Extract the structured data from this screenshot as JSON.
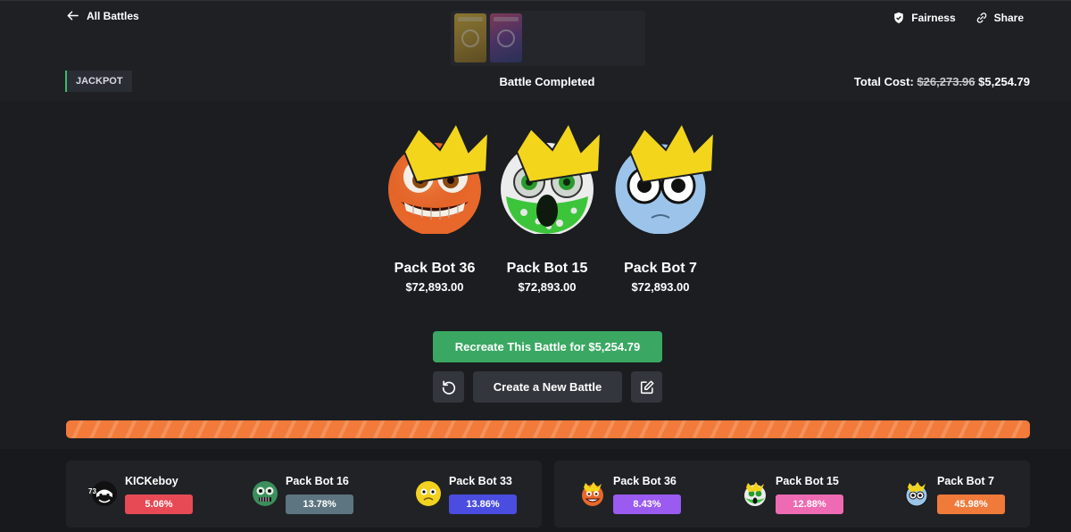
{
  "nav": {
    "back_label": "All Battles"
  },
  "actions": {
    "fairness_label": "Fairness",
    "share_label": "Share"
  },
  "battle": {
    "mode": "JACKPOT",
    "status": "Battle Completed",
    "cost_label": "Total Cost:",
    "cost_original": "$26,273.96",
    "cost_final": "$5,254.79"
  },
  "winners": [
    {
      "name": "Pack Bot 36",
      "amount": "$72,893.00",
      "avatar_icon": "orange-grin-bot-icon"
    },
    {
      "name": "Pack Bot 15",
      "amount": "$72,893.00",
      "avatar_icon": "green-spotted-bot-icon"
    },
    {
      "name": "Pack Bot 7",
      "amount": "$72,893.00",
      "avatar_icon": "blue-eyed-bot-icon"
    }
  ],
  "buttons": {
    "recreate_label": "Recreate This Battle for $5,254.79",
    "new_battle_label": "Create a New Battle"
  },
  "progress": {
    "fraction": 1.0,
    "color": "#f27a3a"
  },
  "teams": [
    {
      "players": [
        {
          "name": "KICKeboy",
          "chance": "5.06%",
          "color": "#e84a55",
          "level": "73",
          "avatar_icon": "ninja-avatar-icon"
        },
        {
          "name": "Pack Bot 16",
          "chance": "13.78%",
          "color": "#5d7580",
          "avatar_icon": "green-zombie-bot-icon"
        },
        {
          "name": "Pack Bot 33",
          "chance": "13.86%",
          "color": "#4a4de0",
          "avatar_icon": "yellow-frown-bot-icon"
        }
      ]
    },
    {
      "players": [
        {
          "name": "Pack Bot 36",
          "chance": "8.43%",
          "color": "#9b5af0",
          "avatar_icon": "crowned-orange-bot-icon"
        },
        {
          "name": "Pack Bot 15",
          "chance": "12.88%",
          "color": "#ee6ab3",
          "avatar_icon": "crowned-green-bot-icon"
        },
        {
          "name": "Pack Bot 7",
          "chance": "45.98%",
          "color": "#f07a3a",
          "avatar_icon": "crowned-blue-bot-icon"
        }
      ]
    }
  ]
}
